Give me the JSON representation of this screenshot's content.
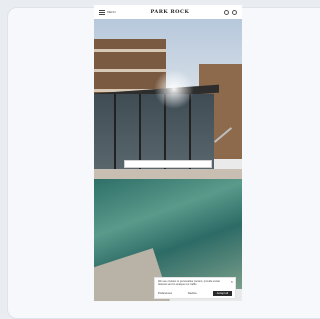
{
  "header": {
    "menu_label": "MENU",
    "brand": "PARK ROCK",
    "icons": [
      "user-icon",
      "cart-icon"
    ]
  },
  "search": {
    "placeholder": ""
  },
  "cookie": {
    "text": "We use cookies to personalise content, provide social features and to analyse our traffic.",
    "close": "×",
    "settings_label": "Preferences",
    "link_label": "Decline",
    "accept_label": "Accept all"
  }
}
